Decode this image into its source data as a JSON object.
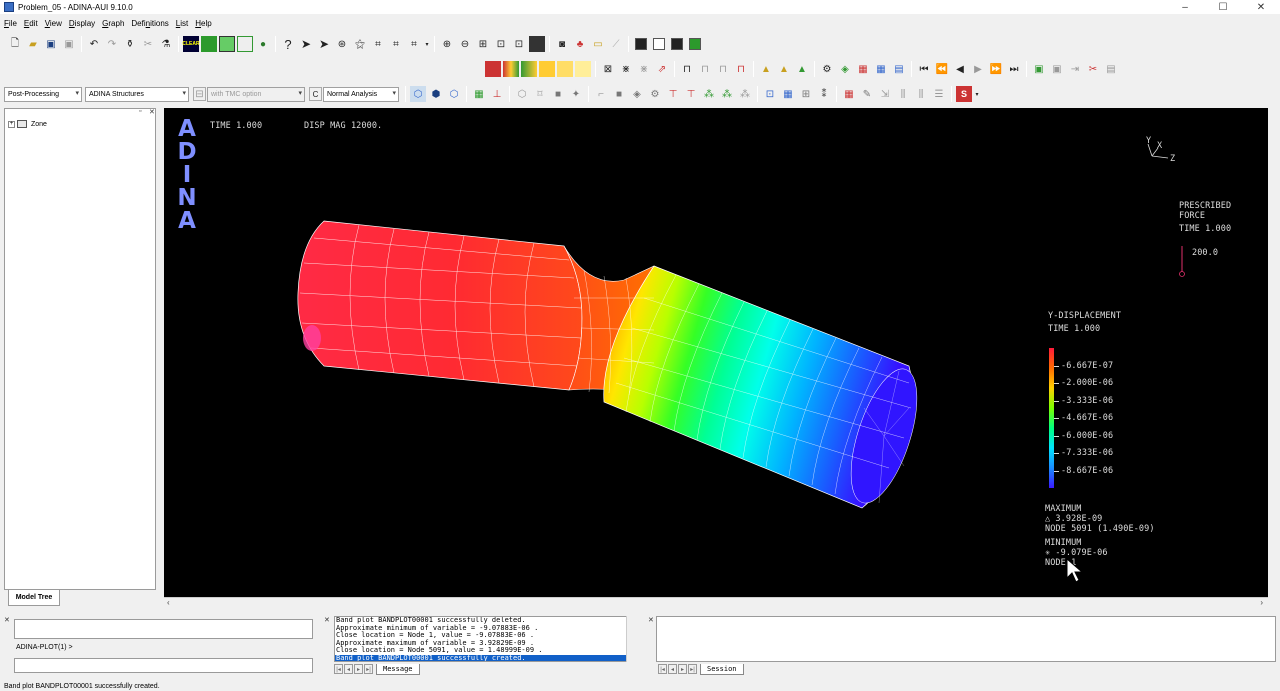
{
  "window": {
    "title": "Problem_05 - ADINA-AUI  9.10.0",
    "minimize": "–",
    "maximize": "☐",
    "close": "✕"
  },
  "menu": [
    {
      "key": "F",
      "rest": "ile"
    },
    {
      "key": "E",
      "rest": "dit"
    },
    {
      "key": "V",
      "rest": "iew"
    },
    {
      "key": "D",
      "rest": "isplay"
    },
    {
      "key": "G",
      "rest": "raph"
    },
    {
      "key": "D",
      "rest": "efinitions",
      "pre": "Defi",
      "post": "itions",
      "mid": "n"
    },
    {
      "key": "L",
      "rest": "ist"
    },
    {
      "key": "H",
      "rest": "elp"
    }
  ],
  "toolbar": {
    "module_combo": "Post-Processing",
    "program_combo": "ADINA Structures",
    "tmc_combo": "with TMC option",
    "analysis_combo": "Normal Analysis",
    "clear_label": "CLEAR"
  },
  "tree": {
    "root": "Zone",
    "tab": "Model Tree"
  },
  "viewport": {
    "logo": [
      "A",
      "D",
      "I",
      "N",
      "A"
    ],
    "time": "TIME 1.000",
    "disp_mag": "DISP MAG 12000.",
    "triad": {
      "y": "Y",
      "x": "X",
      "z": "Z"
    },
    "prescribed": {
      "l1": "PRESCRIBED",
      "l2": "FORCE",
      "l3": "TIME 1.000",
      "value": "200.0"
    },
    "legend": {
      "title": "Y-DISPLACEMENT",
      "time": "TIME 1.000",
      "levels": [
        "-6.667E-07",
        "-2.000E-06",
        "-3.333E-06",
        "-4.667E-06",
        "-6.000E-06",
        "-7.333E-06",
        "-8.667E-06"
      ],
      "colors": [
        "#ff1a3a",
        "#ff6a00",
        "#ffd000",
        "#7dff00",
        "#00ff7f",
        "#00e5ff",
        "#1a8cff",
        "#3a1aff"
      ]
    },
    "extremes": {
      "max_label": "MAXIMUM",
      "max_value": "△  3.928E-09",
      "max_node": "NODE 5091 (1.490E-09)",
      "min_label": "MINIMUM",
      "min_value": "✳  -9.079E-06",
      "min_node": "NODE 1"
    }
  },
  "command": {
    "prompt": "ADINA-PLOT(1) >"
  },
  "messages": {
    "lines": [
      "Band plot BANDPLOT00001 successfully deleted.",
      "Approximate minimum of variable = -9.07883E-06 .",
      "  Close location = Node 1, value = -9.07883E-06 .",
      "  Approximate maximum of variable =  3.92829E-09 .",
      "  Close location = Node 5091, value =  1.48999E-09 .",
      "  Band plot BANDPLOT00001 successfully created."
    ],
    "tab": "Message"
  },
  "session": {
    "tab": "Session"
  },
  "status": "Band plot BANDPLOT00001 successfully created."
}
